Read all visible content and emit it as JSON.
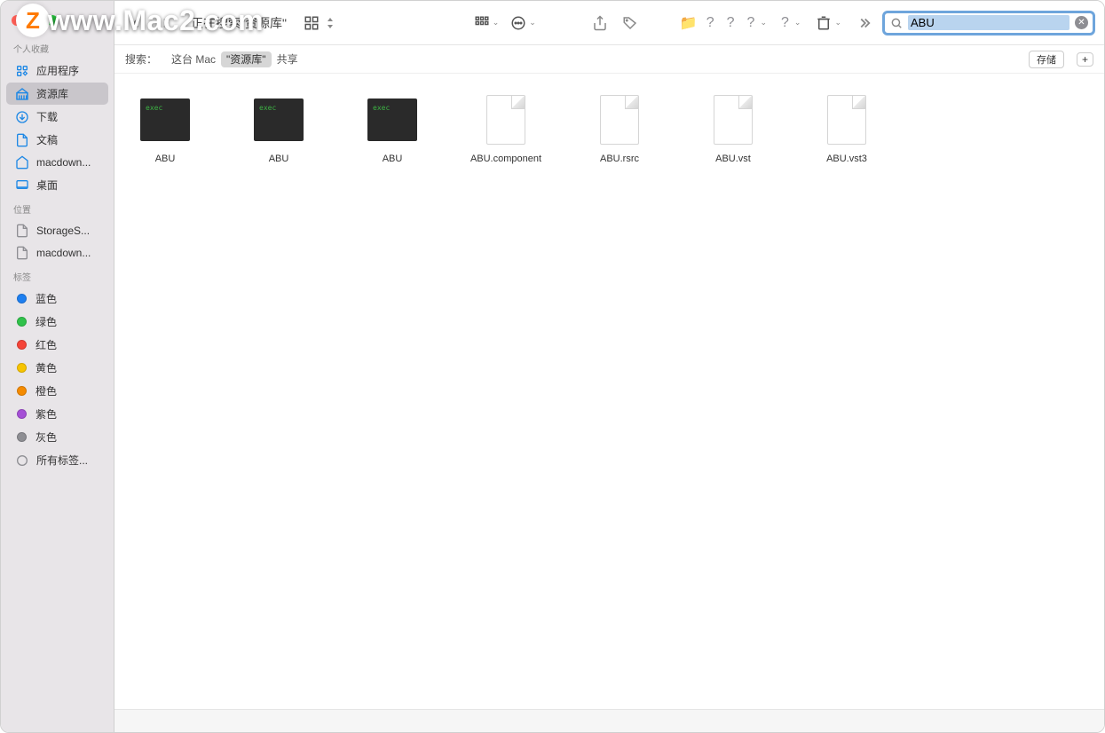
{
  "watermark": {
    "badge": "Z",
    "text": "www.Mac2.com"
  },
  "toolbar": {
    "title": "正在搜索\"资源库\""
  },
  "search": {
    "value": "ABU"
  },
  "scope": {
    "label": "搜索：",
    "items": [
      "这台 Mac",
      "\"资源库\"",
      "共享"
    ],
    "active_index": 1,
    "save": "存储",
    "plus": "+"
  },
  "sidebar": {
    "favorites": {
      "title": "个人收藏",
      "items": [
        {
          "id": "apps",
          "label": "应用程序",
          "icon": "apps"
        },
        {
          "id": "library",
          "label": "资源库",
          "icon": "library",
          "active": true
        },
        {
          "id": "downloads",
          "label": "下载",
          "icon": "downloads"
        },
        {
          "id": "documents",
          "label": "文稿",
          "icon": "documents"
        },
        {
          "id": "macdown",
          "label": "macdown...",
          "icon": "home"
        },
        {
          "id": "desktop",
          "label": "桌面",
          "icon": "desktop"
        }
      ]
    },
    "locations": {
      "title": "位置",
      "items": [
        {
          "id": "storages",
          "label": "StorageS...",
          "icon": "doc"
        },
        {
          "id": "macdown2",
          "label": "macdown...",
          "icon": "doc"
        }
      ]
    },
    "tags": {
      "title": "标签",
      "items": [
        {
          "label": "蓝色",
          "color": "#1e7ff0"
        },
        {
          "label": "绿色",
          "color": "#30c24b"
        },
        {
          "label": "红色",
          "color": "#f54438"
        },
        {
          "label": "黄色",
          "color": "#f7c400"
        },
        {
          "label": "橙色",
          "color": "#f58b00"
        },
        {
          "label": "紫色",
          "color": "#a550d6"
        },
        {
          "label": "灰色",
          "color": "#8e8e93"
        }
      ],
      "all_tags": "所有标签..."
    }
  },
  "files": [
    {
      "name": "ABU",
      "type": "exec"
    },
    {
      "name": "ABU",
      "type": "exec"
    },
    {
      "name": "ABU",
      "type": "exec"
    },
    {
      "name": "ABU.component",
      "type": "doc"
    },
    {
      "name": "ABU.rsrc",
      "type": "doc"
    },
    {
      "name": "ABU.vst",
      "type": "doc"
    },
    {
      "name": "ABU.vst3",
      "type": "doc"
    }
  ],
  "exec_label": "exec"
}
